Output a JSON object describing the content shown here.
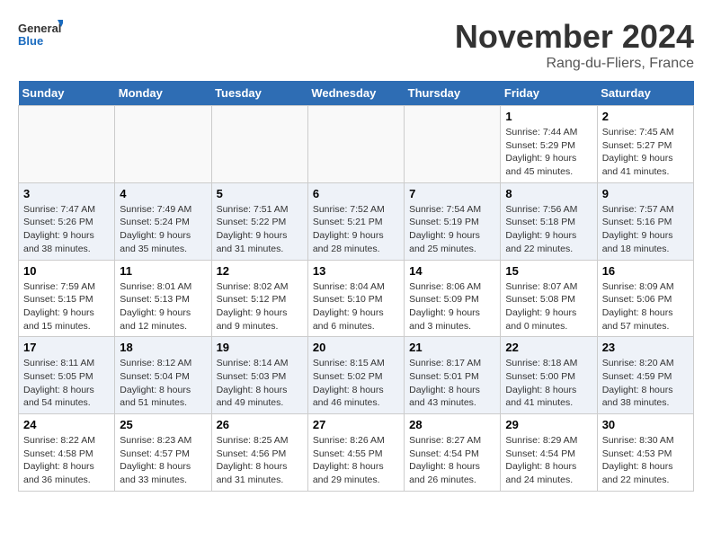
{
  "header": {
    "logo_line1": "General",
    "logo_line2": "Blue",
    "title": "November 2024",
    "subtitle": "Rang-du-Fliers, France"
  },
  "weekdays": [
    "Sunday",
    "Monday",
    "Tuesday",
    "Wednesday",
    "Thursday",
    "Friday",
    "Saturday"
  ],
  "weeks": [
    [
      {
        "day": "",
        "info": ""
      },
      {
        "day": "",
        "info": ""
      },
      {
        "day": "",
        "info": ""
      },
      {
        "day": "",
        "info": ""
      },
      {
        "day": "",
        "info": ""
      },
      {
        "day": "1",
        "info": "Sunrise: 7:44 AM\nSunset: 5:29 PM\nDaylight: 9 hours\nand 45 minutes."
      },
      {
        "day": "2",
        "info": "Sunrise: 7:45 AM\nSunset: 5:27 PM\nDaylight: 9 hours\nand 41 minutes."
      }
    ],
    [
      {
        "day": "3",
        "info": "Sunrise: 7:47 AM\nSunset: 5:26 PM\nDaylight: 9 hours\nand 38 minutes."
      },
      {
        "day": "4",
        "info": "Sunrise: 7:49 AM\nSunset: 5:24 PM\nDaylight: 9 hours\nand 35 minutes."
      },
      {
        "day": "5",
        "info": "Sunrise: 7:51 AM\nSunset: 5:22 PM\nDaylight: 9 hours\nand 31 minutes."
      },
      {
        "day": "6",
        "info": "Sunrise: 7:52 AM\nSunset: 5:21 PM\nDaylight: 9 hours\nand 28 minutes."
      },
      {
        "day": "7",
        "info": "Sunrise: 7:54 AM\nSunset: 5:19 PM\nDaylight: 9 hours\nand 25 minutes."
      },
      {
        "day": "8",
        "info": "Sunrise: 7:56 AM\nSunset: 5:18 PM\nDaylight: 9 hours\nand 22 minutes."
      },
      {
        "day": "9",
        "info": "Sunrise: 7:57 AM\nSunset: 5:16 PM\nDaylight: 9 hours\nand 18 minutes."
      }
    ],
    [
      {
        "day": "10",
        "info": "Sunrise: 7:59 AM\nSunset: 5:15 PM\nDaylight: 9 hours\nand 15 minutes."
      },
      {
        "day": "11",
        "info": "Sunrise: 8:01 AM\nSunset: 5:13 PM\nDaylight: 9 hours\nand 12 minutes."
      },
      {
        "day": "12",
        "info": "Sunrise: 8:02 AM\nSunset: 5:12 PM\nDaylight: 9 hours\nand 9 minutes."
      },
      {
        "day": "13",
        "info": "Sunrise: 8:04 AM\nSunset: 5:10 PM\nDaylight: 9 hours\nand 6 minutes."
      },
      {
        "day": "14",
        "info": "Sunrise: 8:06 AM\nSunset: 5:09 PM\nDaylight: 9 hours\nand 3 minutes."
      },
      {
        "day": "15",
        "info": "Sunrise: 8:07 AM\nSunset: 5:08 PM\nDaylight: 9 hours\nand 0 minutes."
      },
      {
        "day": "16",
        "info": "Sunrise: 8:09 AM\nSunset: 5:06 PM\nDaylight: 8 hours\nand 57 minutes."
      }
    ],
    [
      {
        "day": "17",
        "info": "Sunrise: 8:11 AM\nSunset: 5:05 PM\nDaylight: 8 hours\nand 54 minutes."
      },
      {
        "day": "18",
        "info": "Sunrise: 8:12 AM\nSunset: 5:04 PM\nDaylight: 8 hours\nand 51 minutes."
      },
      {
        "day": "19",
        "info": "Sunrise: 8:14 AM\nSunset: 5:03 PM\nDaylight: 8 hours\nand 49 minutes."
      },
      {
        "day": "20",
        "info": "Sunrise: 8:15 AM\nSunset: 5:02 PM\nDaylight: 8 hours\nand 46 minutes."
      },
      {
        "day": "21",
        "info": "Sunrise: 8:17 AM\nSunset: 5:01 PM\nDaylight: 8 hours\nand 43 minutes."
      },
      {
        "day": "22",
        "info": "Sunrise: 8:18 AM\nSunset: 5:00 PM\nDaylight: 8 hours\nand 41 minutes."
      },
      {
        "day": "23",
        "info": "Sunrise: 8:20 AM\nSunset: 4:59 PM\nDaylight: 8 hours\nand 38 minutes."
      }
    ],
    [
      {
        "day": "24",
        "info": "Sunrise: 8:22 AM\nSunset: 4:58 PM\nDaylight: 8 hours\nand 36 minutes."
      },
      {
        "day": "25",
        "info": "Sunrise: 8:23 AM\nSunset: 4:57 PM\nDaylight: 8 hours\nand 33 minutes."
      },
      {
        "day": "26",
        "info": "Sunrise: 8:25 AM\nSunset: 4:56 PM\nDaylight: 8 hours\nand 31 minutes."
      },
      {
        "day": "27",
        "info": "Sunrise: 8:26 AM\nSunset: 4:55 PM\nDaylight: 8 hours\nand 29 minutes."
      },
      {
        "day": "28",
        "info": "Sunrise: 8:27 AM\nSunset: 4:54 PM\nDaylight: 8 hours\nand 26 minutes."
      },
      {
        "day": "29",
        "info": "Sunrise: 8:29 AM\nSunset: 4:54 PM\nDaylight: 8 hours\nand 24 minutes."
      },
      {
        "day": "30",
        "info": "Sunrise: 8:30 AM\nSunset: 4:53 PM\nDaylight: 8 hours\nand 22 minutes."
      }
    ]
  ]
}
